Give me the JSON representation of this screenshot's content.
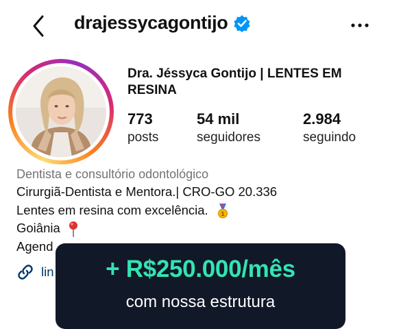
{
  "header": {
    "username": "drajessycagontijo",
    "verified": true,
    "back_icon": "chevron-left-icon",
    "more_icon": "more-horizontal-icon"
  },
  "profile": {
    "full_name": "Dra. Jéssyca Gontijo | LENTES EM RESINA",
    "stats": {
      "posts": {
        "value": "773",
        "label": "posts"
      },
      "followers": {
        "value": "54 mil",
        "label": "seguidores"
      },
      "following": {
        "value": "2.984",
        "label": "seguindo"
      }
    },
    "category": "Dentista e consultório odontológico",
    "bio": [
      "Cirurgiã-Dentista e Mentora.| CRO-GO 20.336",
      "Lentes em resina com excelência.",
      "Goiânia",
      "Agend"
    ],
    "bio_emojis": [
      "medal-icon",
      "pin-icon"
    ],
    "link_text": "lin",
    "link_icon": "link-icon"
  },
  "overlay": {
    "headline": "+ R$250.000/mês",
    "subtext": "com nossa estrutura"
  },
  "colors": {
    "accent_green": "#34e3b3",
    "overlay_bg": "#111827",
    "verified_blue": "#0095f6",
    "link_blue": "#00376b",
    "muted_gray": "#737373"
  }
}
